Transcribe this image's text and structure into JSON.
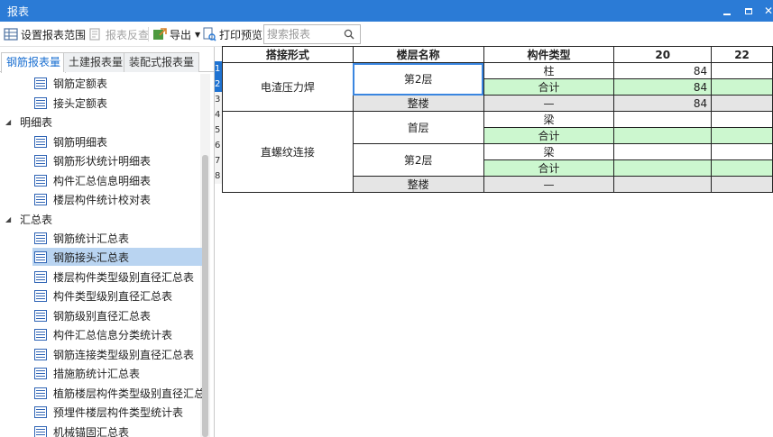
{
  "window": {
    "title": "报表"
  },
  "toolbar": {
    "set_range": "设置报表范围",
    "reverse_check": "报表反查",
    "export": "导出",
    "print_preview": "打印预览",
    "search_placeholder": "搜索报表"
  },
  "tabs": [
    "钢筋报表量",
    "土建报表量",
    "装配式报表量"
  ],
  "tree": {
    "leaf_a": "钢筋定额表",
    "leaf_b": "接头定额表",
    "group_detail": "明细表",
    "detail": [
      "钢筋明细表",
      "钢筋形状统计明细表",
      "构件汇总信息明细表",
      "楼层构件统计校对表"
    ],
    "group_summary": "汇总表",
    "summary": [
      "钢筋统计汇总表",
      "钢筋接头汇总表",
      "楼层构件类型级别直径汇总表",
      "构件类型级别直径汇总表",
      "钢筋级别直径汇总表",
      "构件汇总信息分类统计表",
      "钢筋连接类型级别直径汇总表",
      "措施筋统计汇总表",
      "植筋楼层构件类型级别直径汇总表",
      "预埋件楼层构件类型统计表",
      "机械锚固汇总表"
    ],
    "selected": "钢筋接头汇总表"
  },
  "grid": {
    "headers": [
      "搭接形式",
      "楼层名称",
      "构件类型",
      "20",
      "22"
    ],
    "row_numbers": [
      "1",
      "2",
      "3",
      "4",
      "5",
      "6",
      "7",
      "8"
    ],
    "groups": {
      "g1": "电渣压力焊",
      "g2": "直螺纹连接"
    },
    "floors": {
      "f1": "第2层",
      "f1_total": "整楼",
      "f2": "首层",
      "f3": "第2层",
      "f2_total": "整楼"
    },
    "types": [
      "柱",
      "合计",
      "—",
      "梁",
      "合计",
      "梁",
      "合计",
      "—"
    ],
    "col20": [
      "84",
      "84",
      "84",
      "",
      "",
      "",
      "",
      ""
    ],
    "col22": [
      "",
      "",
      "",
      "",
      "",
      "",
      "",
      ""
    ]
  },
  "colors": {
    "titlebar": "#2b7bd6",
    "accent_tab": "#1a6fd1",
    "selected_tree": "#b9d4f1",
    "subtotal_green": "#ccf7cf",
    "total_gray": "#e5e5e5"
  }
}
